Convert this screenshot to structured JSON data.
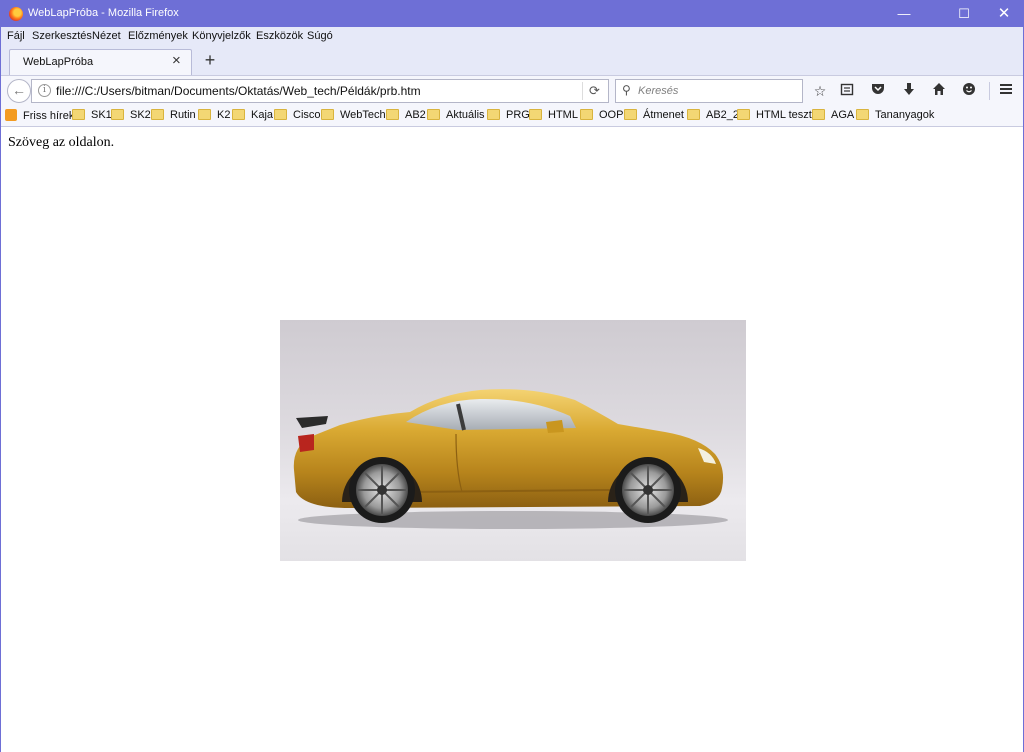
{
  "window": {
    "title": "WebLapPróba - Mozilla Firefox",
    "controls": {
      "minimize": "—",
      "maximize": "☐",
      "close": "✕"
    }
  },
  "menubar": {
    "items": [
      "Fájl",
      "Szerkesztés",
      "Nézet",
      "Előzmények",
      "Könyvjelzők",
      "Eszközök",
      "Súgó"
    ]
  },
  "tabs": [
    {
      "label": "WebLapPróba",
      "active": true
    }
  ],
  "navbar": {
    "url": "file:///C:/Users/bitman/Documents/Oktatás/Web_tech/Példák/prb.htm",
    "search_placeholder": "Keresés",
    "icons": [
      "back-icon",
      "info-icon",
      "reload-icon",
      "search-icon",
      "bookmark-star-icon",
      "reader-list-icon",
      "pocket-icon",
      "download-icon",
      "home-icon",
      "emoji-icon",
      "hamburger-menu-icon"
    ]
  },
  "bookmarks": {
    "items": [
      "Friss hírek",
      "SK1",
      "SK2",
      "Rutin",
      "K2",
      "Kaja",
      "Cisco",
      "WebTech",
      "AB2",
      "Aktuális",
      "PRG",
      "HTML",
      "OOP",
      "Átmenet",
      "AB2_2",
      "HTML teszt",
      "AGA",
      "Tananyagok"
    ]
  },
  "page": {
    "text": "Szöveg az oldalon.",
    "image_subject": "gold sports car"
  },
  "colors": {
    "titlebar": "#6e6fd6",
    "chrome": "#e6e9f8",
    "toolbar": "#f5f6fc",
    "car_gold": "#d4a32a"
  }
}
